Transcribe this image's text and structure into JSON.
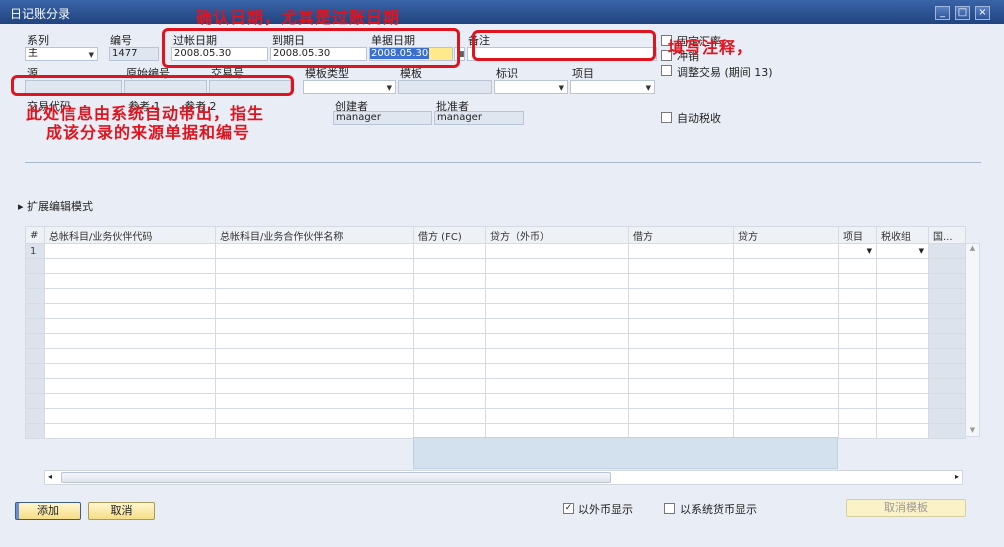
{
  "window": {
    "title": "日记账分录",
    "minimize": "_",
    "maximize": "□",
    "close": "×"
  },
  "header": {
    "series_label": "系列",
    "series_value": "主",
    "number_label": "编号",
    "number_value": "1477",
    "posting_date_label": "过帐日期",
    "posting_date_value": "2008.05.30",
    "due_date_label": "到期日",
    "due_date_value": "2008.05.30",
    "doc_date_label": "单据日期",
    "doc_date_value": "2008.05.30",
    "remarks_label": "备注",
    "remarks_value": "",
    "source_label": "源",
    "orig_no_label": "原始编号",
    "trans_no_label": "交易号",
    "template_type_label": "模板类型",
    "template_label": "模板",
    "indicator_label": "标识",
    "project_label": "项目",
    "trans_code_label": "交易代码",
    "ref1_label": "参考 1",
    "ref2_label": "参考 2",
    "creator_label": "创建者",
    "creator_value": "manager",
    "approver_label": "批准者",
    "approver_value": "manager",
    "fixed_rate_label": "固定汇率",
    "reverse_label": "冲销",
    "adjust_label": "调整交易 (期间 13)",
    "auto_tax_label": "自动税收"
  },
  "expand_label": "扩展编辑模式",
  "table": {
    "columns": [
      "#",
      "总帐科目/业务伙伴代码",
      "总帐科目/业务合作伙伴名称",
      "借方 (FC)",
      "贷方（外币）",
      "借方",
      "贷方",
      "项目",
      "税收组",
      "国..."
    ],
    "first_row": "1"
  },
  "footer": {
    "add": "添加",
    "cancel": "取消",
    "show_fc": "以外币显示",
    "show_fc_checked": true,
    "show_sys": "以系统货币显示",
    "show_sys_checked": false,
    "cancel_template": "取消模板"
  },
  "annotations": {
    "dates": "确认日期，尤其是过账日期",
    "remarks": "填写注释，",
    "source_line1": "此处信息由系统自动带出，指生",
    "source_line2": "成该分录的来源单据和编号"
  },
  "colors": {
    "annotation": "#e0141e",
    "titlebar": "#2a4d8f",
    "button": "#f5de86"
  }
}
